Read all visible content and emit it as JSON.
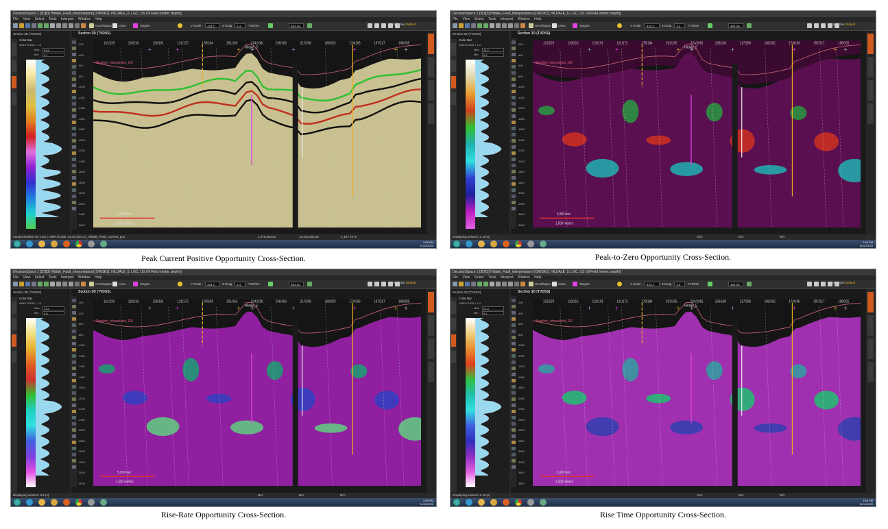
{
  "app": {
    "window_title": "DecisionSpace 1 [3D][3] Hildale_Fault_Interpretation] (OWSK2], HILDALE_5, LGC, US Oil Field (metric depth)]",
    "menus": [
      "File",
      "View",
      "Select",
      "Tools",
      "Interpret",
      "Window",
      "Help"
    ],
    "toolbar": {
      "label_geo": "GeoShapes",
      "label_lines": "Lines",
      "label_targets": "Targets",
      "scale_label": "V Scale",
      "scale_value": "424:1",
      "z_label": "Z Exag",
      "z_value": "1.4",
      "tvd_label": "TVD/SS",
      "depth_value": "402.25",
      "perspective_label": "Perspective",
      "perspective_value": "Default"
    },
    "left_panel": {
      "title": "Section 3D (TVDSS)",
      "color_bar_label": "Color Bar",
      "attribute_label": "AMPLITUDE / 1.0",
      "max_label": "Max",
      "min_label": "Min"
    },
    "section_title": "Section 3D (TVDSS)",
    "well_label": "Hildale_5",
    "horizon_label": "Shoafrim_Interpolated_100",
    "scale_bar": {
      "feet": "5,000 feet",
      "meters": "1,500 meters"
    },
    "depth_ticks": [
      "-200",
      "-400",
      "-600",
      "-800",
      "-1000",
      "-1200",
      "-1400",
      "-1600",
      "-1800",
      "-2000",
      "-2200",
      "-2400",
      "-2600",
      "-2800",
      "-3000",
      "-3200",
      "-3400",
      "-3600"
    ],
    "column_ticks": [
      "131/229",
      "118/216",
      "126/191",
      "131/172",
      "178/184",
      "201/165",
      "224/1081",
      "236/183",
      "217/208",
      "183/202",
      "174/196",
      "197/217",
      "188/205"
    ],
    "clock": {
      "time": "2:59 PM",
      "date": "11/11/2020"
    }
  },
  "panels": [
    {
      "variant": "peak_current",
      "status": "FaultCentreline Ori LGC | AMPLITUDE: 25.93 [18 CO_Hildale_Peak_Current_pos",
      "min_value": "0.1",
      "max_value": "93.9",
      "readout_x": "1,075,693.81",
      "readout_y": "13,443,302.66",
      "readout_z": "-1,167.79 m",
      "caption": "Peak Current Positive Opportunity Cross-Section."
    },
    {
      "variant": "peak_to_zero",
      "status": "Displaying seismic: 0.16 (s)",
      "min_value": "0.1",
      "max_value": "42.2",
      "readout_x": "N/A",
      "readout_y": "N/A",
      "readout_z": "N/A",
      "caption": "Peak-to-Zero Opportunity Cross-Section."
    },
    {
      "variant": "rise_rate",
      "status": "Displaying seismic: 0.2 (s)",
      "min_value": "0.0",
      "max_value": "13.9",
      "readout_x": "N/A",
      "readout_y": "N/A",
      "readout_z": "N/A",
      "caption": "Rise-Rate Opportunity Cross-Section."
    },
    {
      "variant": "rise_time",
      "status": "Displaying seismic: 0.16 (s)",
      "min_value": "0.1",
      "max_value": "21.8",
      "readout_x": "N/A",
      "readout_y": "N/A",
      "readout_z": "N/A",
      "caption": "Rise Time Opportunity Cross-Section."
    }
  ],
  "colors": {
    "accent_orange": "#d05a20",
    "dark_bg": "#1a1a1a",
    "well_yellow": "#e8b020",
    "well_magenta": "#e040e0"
  }
}
